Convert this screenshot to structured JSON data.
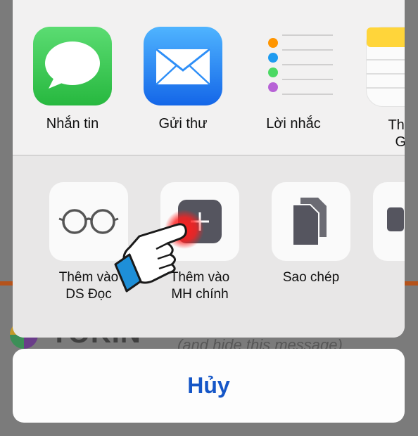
{
  "background": {
    "brand_text": "TOKIN",
    "hint_text": "(and hide this message)"
  },
  "apps": [
    {
      "label": "Nhắn tin",
      "icon": "messages-icon"
    },
    {
      "label": "Gửi thư",
      "icon": "mail-icon"
    },
    {
      "label": "Lời nhắc",
      "icon": "reminders-icon"
    },
    {
      "label": "Thêm\nGhi",
      "icon": "notes-icon"
    }
  ],
  "actions": [
    {
      "label": "Thêm vào\nDS Đọc",
      "icon": "glasses-icon"
    },
    {
      "label": "Thêm vào\nMH chính",
      "icon": "add-to-home-icon"
    },
    {
      "label": "Sao chép",
      "icon": "copy-icon"
    },
    {
      "label": "",
      "icon": "more-action-icon"
    }
  ],
  "cancel_label": "Hủy",
  "colors": {
    "messages_green": "#4cd964",
    "mail_blue": "#2f8ff7",
    "cancel_blue": "#1556c7",
    "tap_highlight": "#ff1e1e"
  }
}
